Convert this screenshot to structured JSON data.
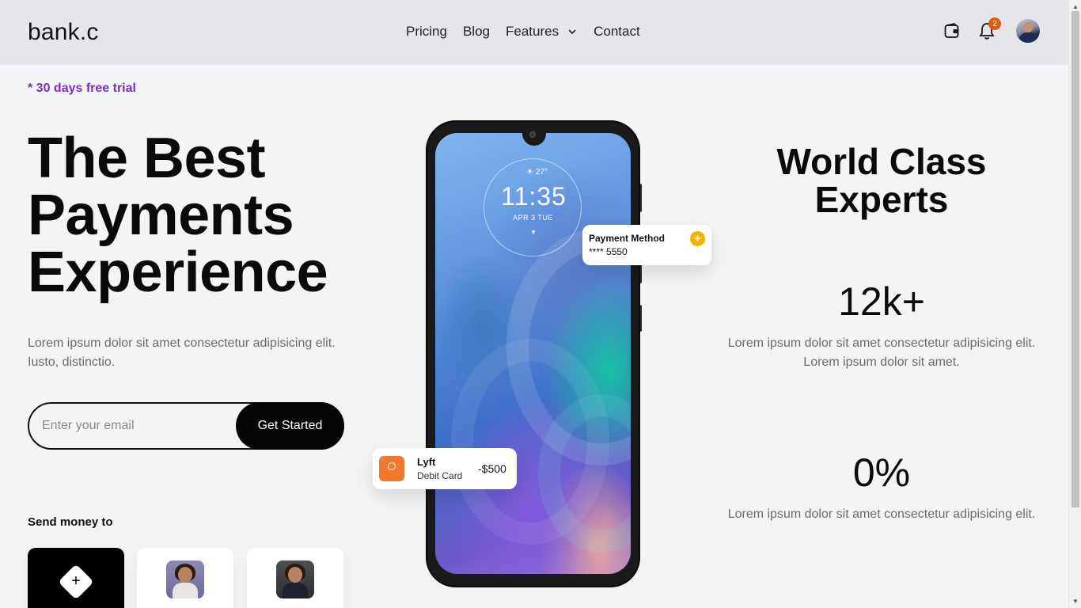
{
  "header": {
    "logo": "bank.c",
    "nav": [
      {
        "label": "Pricing"
      },
      {
        "label": "Blog"
      },
      {
        "label": "Features"
      },
      {
        "label": "Contact"
      }
    ],
    "notification_count": "2",
    "icons": {
      "wallet": "wallet-icon",
      "bell": "bell-icon",
      "avatar": "user-avatar"
    }
  },
  "hero": {
    "trial": "* 30 days free trial",
    "title": "The Best Payments Experience",
    "description": "Lorem ipsum dolor sit amet consectetur adipisicing elit. Iusto, distinctio.",
    "email_placeholder": "Enter your email",
    "cta": "Get Started"
  },
  "send_money": {
    "label": "Send money to",
    "add_symbol": "+"
  },
  "phone": {
    "weather": "☀ 27°",
    "time": "11:35",
    "date": "APR  3  TUE"
  },
  "payment_card": {
    "title": "Payment Method",
    "number": "**** 5550",
    "plus": "+"
  },
  "transaction": {
    "name": "Lyft",
    "type": "Debit Card",
    "amount": "-$500"
  },
  "right": {
    "title": "World Class Experts",
    "stat1": "12k+",
    "stat1_desc": "Lorem ipsum dolor sit amet consectetur adipisicing elit. Lorem ipsum dolor sit amet.",
    "stat2": "0%",
    "stat2_desc": "Lorem ipsum dolor sit amet consectetur adipisicing elit."
  },
  "colors": {
    "accent_purple": "#7c2dcc",
    "badge_orange": "#ea580c",
    "plus_yellow": "#f5b301",
    "lyft_orange": "#f0782f"
  }
}
